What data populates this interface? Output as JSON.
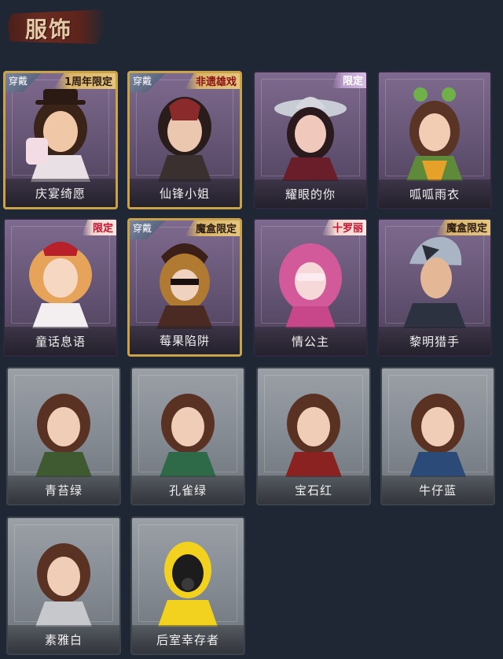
{
  "header": {
    "title": "服饰"
  },
  "tags": {
    "equipped": "穿戴",
    "anniversary": "1周年限定",
    "heritage": "非遗雄戏",
    "limited": "限定",
    "magic_box_limited": "魔盒限定",
    "collab": "十罗丽"
  },
  "costumes": [
    {
      "name": "庆宴绮愿",
      "style": "purple",
      "equipped": true
    },
    {
      "name": "仙锋小姐",
      "style": "purple",
      "equipped": true
    },
    {
      "name": "耀眼的你",
      "style": "purple",
      "equipped": false
    },
    {
      "name": "呱呱雨衣",
      "style": "purple",
      "equipped": false
    },
    {
      "name": "童话息语",
      "style": "purple",
      "equipped": false
    },
    {
      "name": "莓果陷阱",
      "style": "purple",
      "equipped": true
    },
    {
      "name": "情公主",
      "style": "purple",
      "equipped": false
    },
    {
      "name": "黎明猎手",
      "style": "purple",
      "equipped": false
    },
    {
      "name": "青苔绿",
      "style": "grey",
      "equipped": false
    },
    {
      "name": "孔雀绿",
      "style": "grey",
      "equipped": false
    },
    {
      "name": "宝石红",
      "style": "grey",
      "equipped": false
    },
    {
      "name": "牛仔蓝",
      "style": "grey",
      "equipped": false
    },
    {
      "name": "素雅白",
      "style": "grey",
      "equipped": false
    },
    {
      "name": "后室幸存者",
      "style": "grey",
      "equipped": false
    }
  ],
  "colors": {
    "background": "#1e2733",
    "card_purple": "#6f5c80",
    "card_grey": "#8a9096",
    "equipped_border": "#c9a24a"
  }
}
